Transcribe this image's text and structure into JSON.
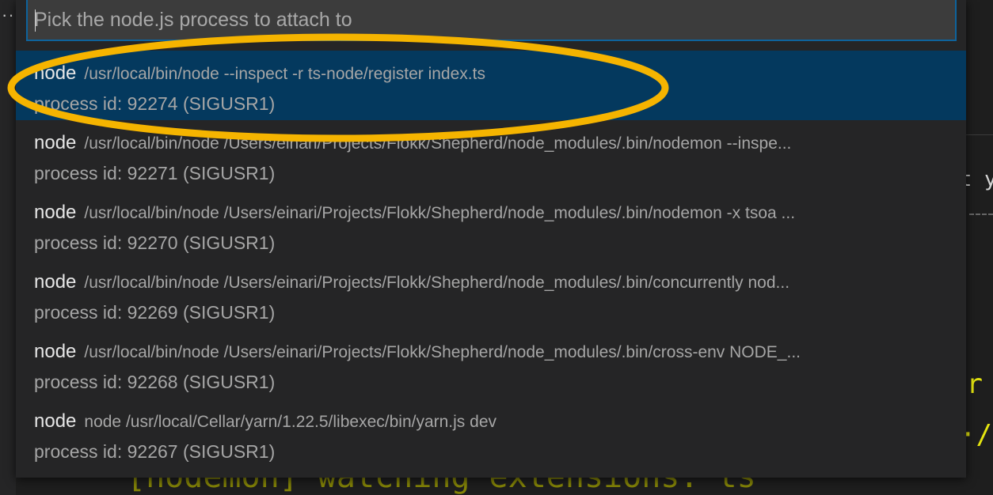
{
  "quickpick": {
    "placeholder": "Pick the node.js process to attach to",
    "value": ""
  },
  "items": [
    {
      "label": "node",
      "description": "/usr/local/bin/node --inspect -r ts-node/register index.ts",
      "detail": "process id: 92274 (SIGUSR1)",
      "selected": true
    },
    {
      "label": "node",
      "description": "/usr/local/bin/node /Users/einari/Projects/Flokk/Shepherd/node_modules/.bin/nodemon --inspe...",
      "detail": "process id: 92271 (SIGUSR1)",
      "selected": false
    },
    {
      "label": "node",
      "description": "/usr/local/bin/node /Users/einari/Projects/Flokk/Shepherd/node_modules/.bin/nodemon -x tsoa ...",
      "detail": "process id: 92270 (SIGUSR1)",
      "selected": false
    },
    {
      "label": "node",
      "description": "/usr/local/bin/node /Users/einari/Projects/Flokk/Shepherd/node_modules/.bin/concurrently nod...",
      "detail": "process id: 92269 (SIGUSR1)",
      "selected": false
    },
    {
      "label": "node",
      "description": "/usr/local/bin/node /Users/einari/Projects/Flokk/Shepherd/node_modules/.bin/cross-env NODE_...",
      "detail": "process id: 92268 (SIGUSR1)",
      "selected": false
    },
    {
      "label": "node",
      "description": "node /usr/local/Cellar/yarn/1.22.5/libexec/bin/yarn.js dev",
      "detail": "process id: 92267 (SIGUSR1)",
      "selected": false
    }
  ],
  "background": {
    "more_glyph": "···",
    "fragment_right_1": "at y",
    "fragment_right_2": "er",
    "fragment_right_3": "·/",
    "fragment_bottom": "[nodemon] watching extensions: ts"
  },
  "colors": {
    "selection": "#04395e",
    "input_border": "#0e639c",
    "highlight_ring": "#f5b400",
    "terminal_yellow": "#e5e510"
  }
}
